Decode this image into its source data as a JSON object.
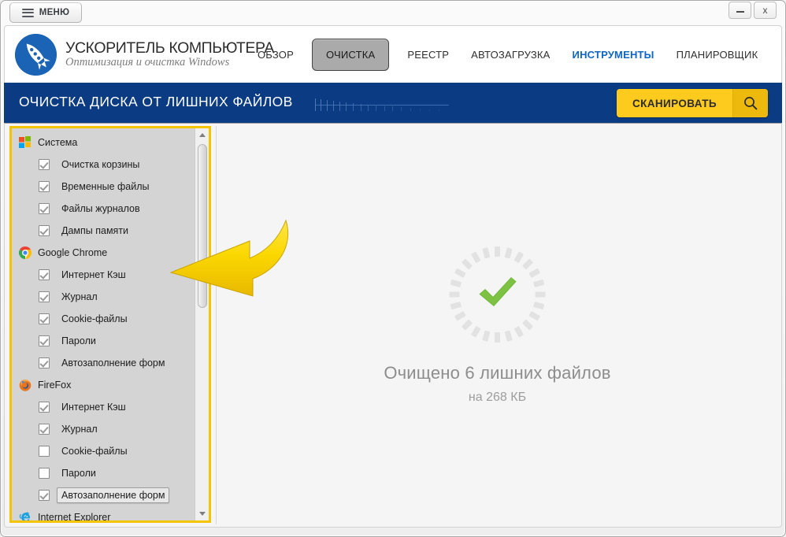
{
  "window": {
    "menu_button_label": "МЕНЮ",
    "minimize_label": "–",
    "close_label": "x"
  },
  "brand": {
    "name": "УСКОРИТЕЛЬ КОМПЬЮТЕРА",
    "tagline": "Оптимизация и очистка Windows",
    "logo_icon": "rocket-icon",
    "logo_color": "#1b63b4"
  },
  "nav": {
    "items": [
      {
        "label": "ОБЗОР",
        "state": "normal"
      },
      {
        "label": "ОЧИСТКА",
        "state": "active"
      },
      {
        "label": "РЕЕСТР",
        "state": "normal"
      },
      {
        "label": "АВТОЗАГРУЗКА",
        "state": "normal"
      },
      {
        "label": "ИНСТРУМЕНТЫ",
        "state": "hover"
      },
      {
        "label": "ПЛАНИРОВЩИК",
        "state": "normal"
      }
    ]
  },
  "banner": {
    "title": "ОЧИСТКА ДИСКА ОТ ЛИШНИХ ФАЙЛОВ",
    "background_color": "#0b3b82",
    "scan_button_label": "СКАНИРОВАТЬ",
    "scan_button_color": "#fcc816",
    "scan_icon": "search-icon"
  },
  "tree": {
    "border_color": "#f5c400",
    "groups": [
      {
        "label": "Система",
        "icon": "windows-logo-icon",
        "children": [
          {
            "label": "Очистка корзины",
            "checked": true,
            "selected": false
          },
          {
            "label": "Временные файлы",
            "checked": true,
            "selected": false
          },
          {
            "label": "Файлы журналов",
            "checked": true,
            "selected": false
          },
          {
            "label": "Дампы памяти",
            "checked": true,
            "selected": false
          }
        ]
      },
      {
        "label": "Google Chrome",
        "icon": "chrome-logo-icon",
        "children": [
          {
            "label": "Интернет Кэш",
            "checked": true,
            "selected": false
          },
          {
            "label": "Журнал",
            "checked": true,
            "selected": false
          },
          {
            "label": "Cookie-файлы",
            "checked": true,
            "selected": false
          },
          {
            "label": "Пароли",
            "checked": true,
            "selected": false
          },
          {
            "label": "Автозаполнение форм",
            "checked": true,
            "selected": false
          }
        ]
      },
      {
        "label": "FireFox",
        "icon": "firefox-logo-icon",
        "children": [
          {
            "label": "Интернет Кэш",
            "checked": true,
            "selected": false
          },
          {
            "label": "Журнал",
            "checked": true,
            "selected": false
          },
          {
            "label": "Cookie-файлы",
            "checked": false,
            "selected": false
          },
          {
            "label": "Пароли",
            "checked": false,
            "selected": false
          },
          {
            "label": "Автозаполнение форм",
            "checked": true,
            "selected": true
          }
        ]
      },
      {
        "label": "Internet Explorer",
        "icon": "internet-explorer-logo-icon",
        "children": []
      }
    ]
  },
  "result": {
    "status_icon": "green-check-icon",
    "title": "Очищено 6 лишних файлов",
    "subtitle": "на 268 КБ",
    "files_cleaned": 6,
    "size_freed": "268 КБ"
  },
  "annotation": {
    "arrow_icon": "curved-arrow-left-icon",
    "arrow_color": "#f2d000"
  }
}
